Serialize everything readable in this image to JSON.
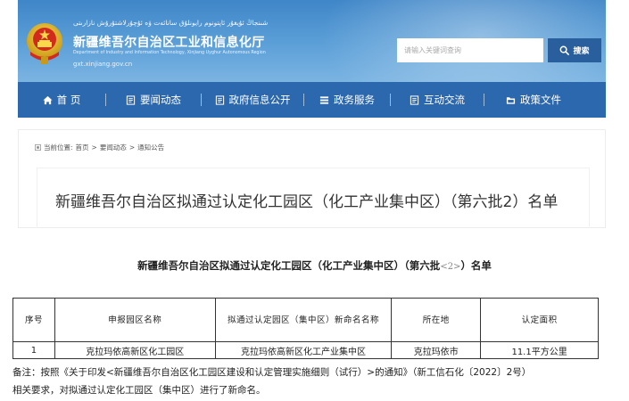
{
  "header": {
    "uyghur_name": "شىنجاڭ ئۇيغۇر ئاپتونوم رايونلۇق سانائەت ۋە ئۇچۇرلاشتۇرۇش نازارىتى",
    "dept_name": "新疆维吾尔自治区工业和信息化厅",
    "dept_name_en": "Department of Industry and Information Technology, Xinjiang Uyghur Autonomous Region",
    "url": "gxt.xinjiang.gov.cn"
  },
  "search": {
    "placeholder": "请输入关键词查询",
    "button_label": "搜索",
    "icon": "search-icon"
  },
  "nav": {
    "items": [
      {
        "label": "首 页",
        "icon": "home-icon"
      },
      {
        "label": "要闻动态",
        "icon": "document-icon"
      },
      {
        "label": "政府信息公开",
        "icon": "document-icon"
      },
      {
        "label": "政务服务",
        "icon": "list-icon"
      },
      {
        "label": "互动交流",
        "icon": "document-icon"
      },
      {
        "label": "政策文件",
        "icon": "folder-icon"
      }
    ]
  },
  "breadcrumb": {
    "prefix": "当前位置:",
    "items": [
      "首页",
      "要闻动态",
      "通知公告"
    ],
    "separator": ">"
  },
  "page_title": "新疆维吾尔自治区拟通过认定化工园区（化工产业集中区）（第六批2）名单",
  "document": {
    "title": "新疆维吾尔自治区拟通过认定化工园区（化工产业集中区）（第六批",
    "title_num": "<2>",
    "title_tail": "）名单",
    "table": {
      "headers": [
        "序号",
        "申报园区名称",
        "拟通过认定园区（集中区）新命名名称",
        "所在地",
        "认定面积"
      ],
      "rows": [
        [
          "1",
          "克拉玛依高新区化工园区",
          "克拉玛依高新区化工产业集中区",
          "克拉玛依市",
          "11.1平方公里"
        ]
      ]
    },
    "note_line1": "备注：按照《关于印发<新疆维吾尔自治区化工园区建设和认定管理实施细则（试行）>的通知》（新工信石化〔2022〕2号）",
    "note_line2": "相关要求，对拟通过认定化工园区（集中区）进行了新命名。"
  },
  "colors": {
    "nav_bg": "#2c68ad",
    "header_bg": "#4a8fd0",
    "search_button_bg": "#2a5f9e"
  }
}
